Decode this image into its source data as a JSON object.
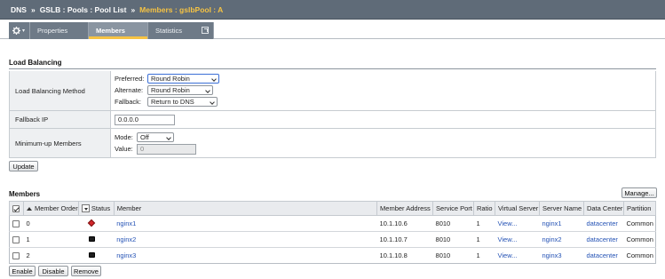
{
  "breadcrumb": {
    "root": "DNS",
    "sep": "»",
    "gslb": "GSLB : Pools : Pool List",
    "current": "Members : gslbPool : A"
  },
  "tabs": {
    "gear_caret": "▾",
    "properties": "Properties",
    "members": "Members",
    "statistics": "Statistics"
  },
  "load_balancing": {
    "title": "Load Balancing",
    "method_label": "Load Balancing Method",
    "preferred_label": "Preferred:",
    "preferred_value": "Round Robin",
    "alternate_label": "Alternate:",
    "alternate_value": "Round Robin",
    "fallback_label": "Fallback:",
    "fallback_value": "Return to DNS",
    "fallback_ip_label": "Fallback IP",
    "fallback_ip_value": "0.0.0.0",
    "min_up_label": "Minimum-up Members",
    "mode_label": "Mode:",
    "mode_value": "Off",
    "value_label": "Value:",
    "value_value": "0",
    "update_button": "Update"
  },
  "members": {
    "title": "Members",
    "manage_button": "Manage...",
    "columns": {
      "member_order": "Member Order",
      "status": "Status",
      "member": "Member",
      "member_address": "Member Address",
      "service_port": "Service Port",
      "ratio": "Ratio",
      "virtual_server": "Virtual Server",
      "server_name": "Server Name",
      "data_center": "Data Center",
      "partition": "Partition"
    },
    "rows": [
      {
        "order": "0",
        "status": "red",
        "member": "nginx1",
        "address": "10.1.10.6",
        "port": "8010",
        "ratio": "1",
        "virtual_server": "View...",
        "server_name": "nginx1",
        "data_center": "datacenter",
        "partition": "Common"
      },
      {
        "order": "1",
        "status": "black",
        "member": "nginx2",
        "address": "10.1.10.7",
        "port": "8010",
        "ratio": "1",
        "virtual_server": "View...",
        "server_name": "nginx2",
        "data_center": "datacenter",
        "partition": "Common"
      },
      {
        "order": "2",
        "status": "black",
        "member": "nginx3",
        "address": "10.1.10.8",
        "port": "8010",
        "ratio": "1",
        "virtual_server": "View...",
        "server_name": "nginx3",
        "data_center": "datacenter",
        "partition": "Common"
      }
    ],
    "buttons": {
      "enable": "Enable",
      "disable": "Disable",
      "remove": "Remove"
    }
  },
  "colors": {
    "header_bg": "#5f6b78",
    "accent": "#f6c343",
    "link": "#2553b5",
    "status_red": "#d3262a"
  },
  "icons": {
    "gear": "gear-icon",
    "external": "external-link-icon",
    "status_unavailable": "red-diamond-icon",
    "status_disabled": "black-square-icon"
  }
}
